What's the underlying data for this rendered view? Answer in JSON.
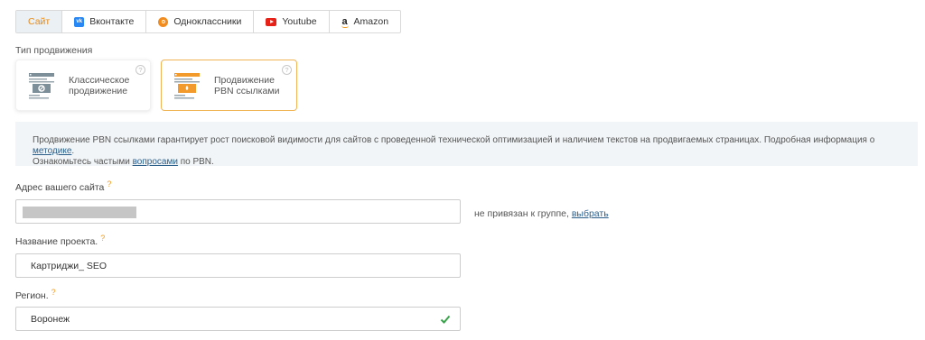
{
  "tabs": [
    {
      "label": "Сайт",
      "icon": "",
      "active": true
    },
    {
      "label": "Вконтакте",
      "icon": "vk-icon"
    },
    {
      "label": "Одноклассники",
      "icon": "odnoklassniki-icon"
    },
    {
      "label": "Youtube",
      "icon": "youtube-icon"
    },
    {
      "label": "Amazon",
      "icon": "amazon-icon"
    }
  ],
  "promotion": {
    "label": "Тип продвижения",
    "options": [
      {
        "title_line1": "Классическое",
        "title_line2": "продвижение",
        "icon": "classic-promotion-icon",
        "help": "?",
        "selected": false
      },
      {
        "title_line1": "Продвижение",
        "title_line2": "PBN ссылками",
        "icon": "pbn-promotion-icon",
        "help": "?",
        "selected": true
      }
    ]
  },
  "info": {
    "line1_text": "Продвижение PBN ссылками гарантирует рост поисковой видимости для сайтов с проведенной технической оптимизацией и наличием текстов на продвигаемых страницах. Подробная информация о ",
    "line1_link": "методике",
    "line1_end": ".",
    "line2_text": "Ознакомьтесь частыми ",
    "line2_link": "вопросами",
    "line2_end": " по PBN."
  },
  "site_address": {
    "label": "Адрес вашего сайта",
    "required_mark": "?",
    "value": "",
    "group_note": "не привязан к группе, ",
    "group_link": "выбрать"
  },
  "project_name": {
    "label": "Название проекта.",
    "required_mark": "?",
    "value": "Картриджи_ SEO"
  },
  "region": {
    "label": "Регион.",
    "required_mark": "?",
    "value": "Воронеж"
  },
  "colors": {
    "accent": "#e98a15",
    "link": "#2b5f8a",
    "success": "#3aa14b",
    "selected_border": "#f0b454"
  }
}
